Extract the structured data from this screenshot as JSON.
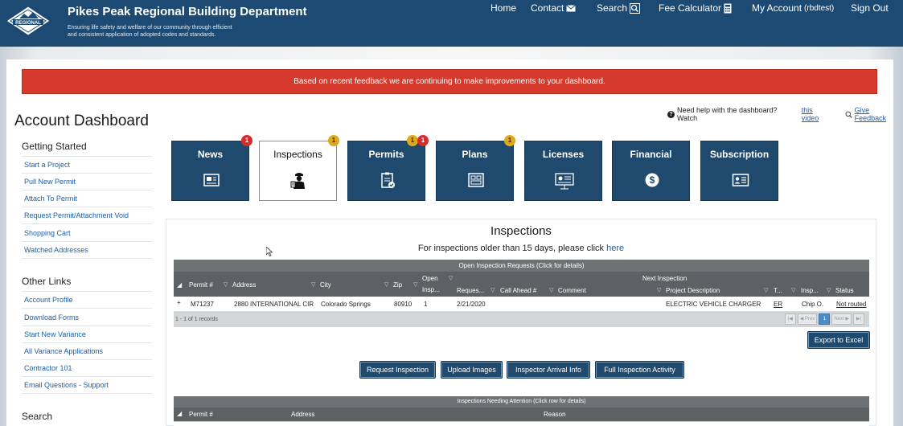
{
  "header": {
    "org_name": "Pikes Peak Regional Building Department",
    "tagline_line1": "Ensuring life safety and welfare of our community through efficient",
    "tagline_line2": "and consistent application of adopted codes and standards.",
    "logo_text": "REGIONAL",
    "nav": {
      "home": "Home",
      "contact": "Contact",
      "search": "Search",
      "fee_calculator": "Fee Calculator",
      "my_account": "My Account",
      "username": "(rbdtest)",
      "sign_out": "Sign Out"
    }
  },
  "banner": {
    "text": "Based on recent feedback we are continuing to make improvements to your dashboard."
  },
  "help": {
    "prefix": "Need help with the dashboard? Watch",
    "video_link": "this video",
    "feedback_link": "Give Feedback"
  },
  "sidebar": {
    "title": "Account Dashboard",
    "getting_started": {
      "heading": "Getting Started",
      "items": [
        "Start a Project",
        "Pull New Permit",
        "Attach To Permit",
        "Request Permit/Attachment Void",
        "Shopping Cart",
        "Watched Addresses"
      ]
    },
    "other_links": {
      "heading": "Other Links",
      "items": [
        "Account Profile",
        "Download Forms",
        "Start New Variance",
        "All Variance Applications",
        "Contractor 101",
        "Email Questions - Support"
      ]
    },
    "search_heading": "Search"
  },
  "tiles": [
    {
      "label": "News",
      "icon": "newspaper-icon"
    },
    {
      "label": "Inspections",
      "icon": "inspector-icon"
    },
    {
      "label": "Permits",
      "icon": "clipboard-check-icon"
    },
    {
      "label": "Plans",
      "icon": "blueprint-icon"
    },
    {
      "label": "Licenses",
      "icon": "license-icon"
    },
    {
      "label": "Financial",
      "icon": "dollar-icon"
    },
    {
      "label": "Subscription",
      "icon": "id-card-icon"
    }
  ],
  "badges": {
    "news": "1",
    "inspections": "1",
    "permits_yellow": "1",
    "permits_red": "1",
    "plans": "1"
  },
  "inspections": {
    "title": "Inspections",
    "sub_prefix": "For inspections older than 15 days, please click",
    "sub_link": "here",
    "grid": {
      "title": "Open Inspection Requests (Click for details)",
      "headers": {
        "permit": "Permit #",
        "address": "Address",
        "city": "City",
        "zip": "Zip",
        "open_insp_1": "Open",
        "open_insp_2": "Insp...",
        "next_inspection": "Next Inspection",
        "requested": "Reques...",
        "call_ahead": "Call Ahead #",
        "comment": "Comment",
        "project_description": "Project Description",
        "type": "T...",
        "inspector": "Insp...",
        "status": "Status"
      },
      "row": {
        "permit": "M71237",
        "address": "2880 INTERNATIONAL CIR",
        "city": "Colorado Springs",
        "zip": "80910",
        "open": "1",
        "requested": "2/21/2020",
        "project_description": "ELECTRIC VEHICLE CHARGER",
        "type": "ER",
        "inspector": "Chip O.",
        "status": "Not routed"
      },
      "records": "1 - 1 of 1 records",
      "pager": {
        "prev": "Prev",
        "page": "1",
        "next": "Next"
      }
    },
    "export_label": "Export to Excel",
    "buttons": {
      "request": "Request Inspection",
      "upload": "Upload Images",
      "arrival": "Inspector Arrival Info",
      "activity": "Full Inspection Activity"
    },
    "grid2": {
      "title": "Inspections Needing Attention (Click row for details)",
      "headers": {
        "permit": "Permit #",
        "address": "Address",
        "reason": "Reason"
      }
    }
  }
}
